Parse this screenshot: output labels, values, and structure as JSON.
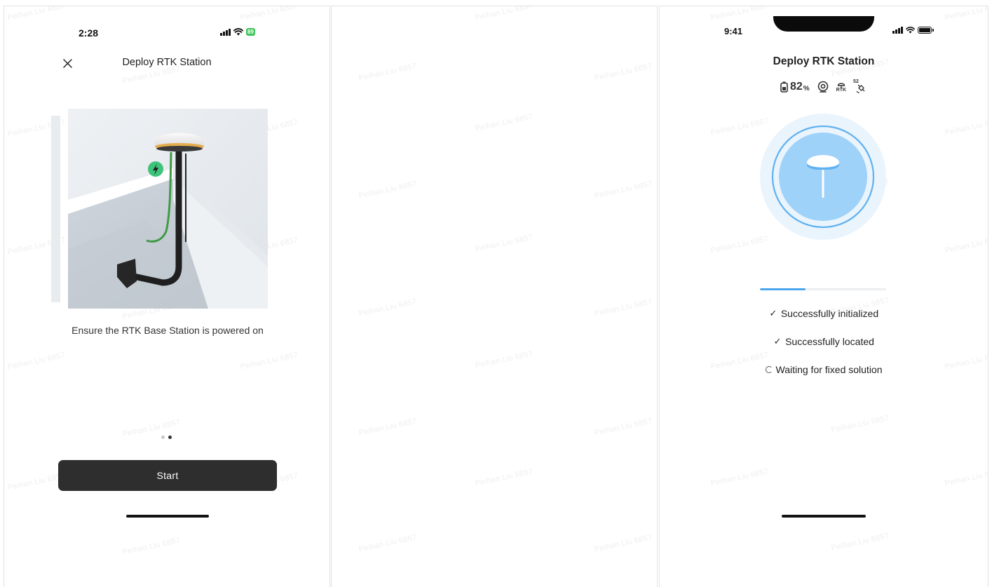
{
  "screen1": {
    "time": "2:28",
    "battery": "89",
    "title": "Deploy RTK Station",
    "caption": "Ensure the RTK Base Station is powered on",
    "start_label": "Start",
    "page_count": 2,
    "active_page": 2
  },
  "screen3": {
    "time": "9:41",
    "title": "Deploy RTK Station",
    "device_battery_value": "82",
    "device_battery_unit": "%",
    "satellites": "52",
    "rtk_icon_label": "RTK",
    "progress": 0.36,
    "steps": [
      {
        "label": "Successfully initialized",
        "state": "done"
      },
      {
        "label": "Successfully located",
        "state": "done"
      },
      {
        "label": "Waiting for fixed solution",
        "state": "pending"
      }
    ]
  },
  "watermark": "Peihan.Liu 6857",
  "colors": {
    "accent_blue": "#4aa6ee",
    "button_dark": "#2e2e2e",
    "battery_green": "#3fc45a",
    "power_green": "#3ec47a"
  }
}
